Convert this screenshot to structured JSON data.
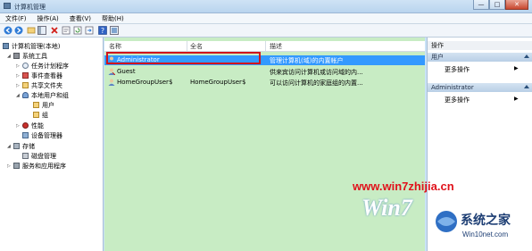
{
  "window": {
    "title": "计算机管理",
    "btn_min": "—",
    "btn_max": "□",
    "btn_close": "✕"
  },
  "menu": [
    "文件(F)",
    "操作(A)",
    "查看(V)",
    "帮助(H)"
  ],
  "toolbar": {
    "icons": [
      "back-icon",
      "forward-icon",
      "up-icon",
      "show-hide-tree-icon",
      "delete-icon",
      "properties-icon",
      "refresh-icon",
      "export-icon",
      "help-icon",
      "view-icon"
    ]
  },
  "tree": {
    "root": "计算机管理(本地)",
    "system_tools": "系统工具",
    "task_scheduler": "任务计划程序",
    "event_viewer": "事件查看器",
    "shared_folders": "共享文件夹",
    "local_users": "本地用户和组",
    "users": "用户",
    "groups": "组",
    "performance": "性能",
    "device_manager": "设备管理器",
    "storage": "存储",
    "disk_management": "磁盘管理",
    "services": "服务和应用程序"
  },
  "list": {
    "headers": {
      "name": "名称",
      "fullname": "全名",
      "desc": "描述"
    },
    "rows": [
      {
        "name": "Administrator",
        "fullname": "",
        "desc": "管理计算机(域)的内置帐户"
      },
      {
        "name": "Guest",
        "fullname": "",
        "desc": "供来宾访问计算机或访问域的内..."
      },
      {
        "name": "HomeGroupUser$",
        "fullname": "HomeGroupUser$",
        "desc": "可以访问计算机的家庭组的内置..."
      }
    ]
  },
  "actions": {
    "header": "操作",
    "section1": "用户",
    "section1_item": "更多操作",
    "section2": "Administrator",
    "section2_item": "更多操作"
  },
  "watermark": {
    "url": "www.win7zhijia.cn",
    "logo": "Win7",
    "brand_cn": "系统之家",
    "brand_url": "Win10net.com"
  },
  "colors": {
    "selection": "#3399ff",
    "list_bg": "#c8ecc4",
    "highlight_box": "#d1141b",
    "watermark_red": "#e0121b"
  }
}
